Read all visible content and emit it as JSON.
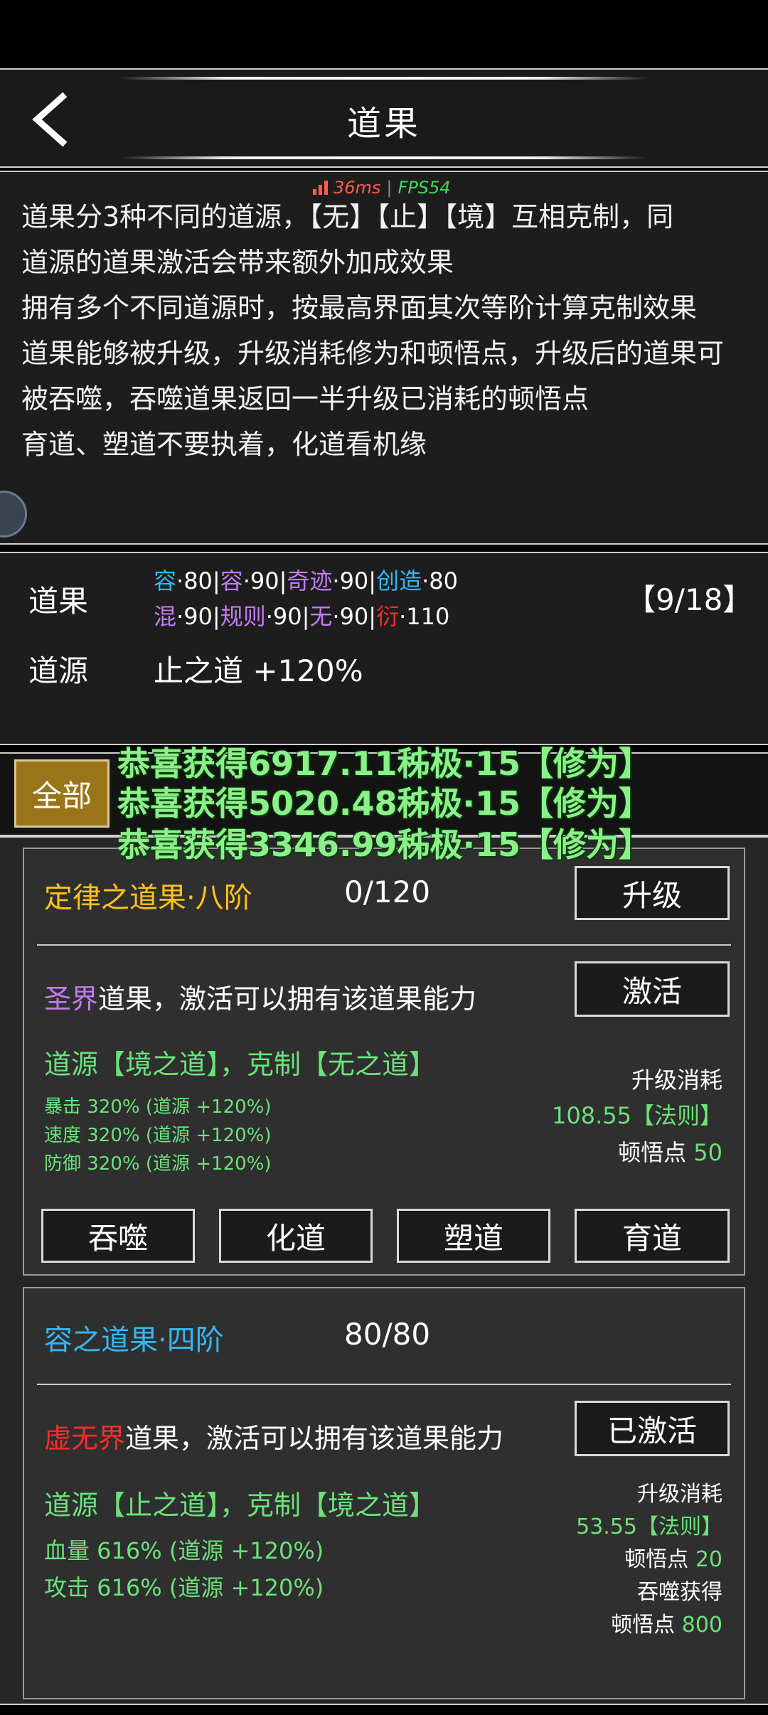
{
  "header": {
    "title": "道果"
  },
  "perf": {
    "ms": "36ms",
    "fps": "FPS54"
  },
  "description": {
    "lines": [
      "道果分3种不同的道源，【无】【止】【境】互相克制，同",
      "道源的道果激活会带来额外加成效果",
      "拥有多个不同道源时，按最高界面其次等阶计算克制效果",
      "道果能够被升级，升级消耗修为和顿悟点，升级后的道果可",
      "被吞噬，吞噬道果返回一半升级已消耗的顿悟点",
      "育道、塑道不要执着，化道看机缘"
    ]
  },
  "stats": {
    "daoguo_label": "道果",
    "daoyuan_label": "道源",
    "row1": [
      {
        "name": "容",
        "level": "·80",
        "color": "#35b6f0"
      },
      {
        "name": "容",
        "level": "·90",
        "color": "#c37bf2"
      },
      {
        "name": "奇迹",
        "level": "·90",
        "color": "#c37bf2"
      },
      {
        "name": "创造",
        "level": "·80",
        "color": "#35b6f0"
      }
    ],
    "row2": [
      {
        "name": "混",
        "level": "·90",
        "color": "#c37bf2"
      },
      {
        "name": "规则",
        "level": "·90",
        "color": "#c37bf2"
      },
      {
        "name": "无",
        "level": "·90",
        "color": "#c37bf2"
      },
      {
        "name": "衍",
        "level": "·110",
        "color": "#ff2c2c"
      }
    ],
    "count": "【9/18】",
    "daoyuan_value": "止之道 +120%"
  },
  "tabs": {
    "all": "全部"
  },
  "toasts": [
    "恭喜获得6917.11秭极·15【修为】",
    "恭喜获得5020.48秭极·15【修为】",
    "恭喜获得3346.99秭极·15【修为】"
  ],
  "cards": [
    {
      "name": "定律之道果·八阶",
      "progress": "0/120",
      "top_button": "升级",
      "realm": "圣界",
      "ability_text": "道果，激活可以拥有该道果能力",
      "activate_button": "激活",
      "daoyuan": "道源【境之道】，克制【无之道】",
      "effects": [
        "暴击 320% (道源 +120%)",
        "速度 320% (道源 +120%)",
        "防御 320% (道源 +120%)"
      ],
      "cost_label": "升级消耗",
      "cost_value": "108.55【法则】",
      "insight_label": "顿悟点",
      "insight_value": "50",
      "actions": [
        "吞噬",
        "化道",
        "塑道",
        "育道"
      ]
    },
    {
      "name": "容之道果·四阶",
      "progress": "80/80",
      "realm": "虚无界",
      "ability_text": "道果，激活可以拥有该道果能力",
      "activate_button": "已激活",
      "daoyuan": "道源【止之道】，克制【境之道】",
      "effects": [
        "血量 616% (道源 +120%)",
        "攻击 616% (道源 +120%)"
      ],
      "cost_label": "升级消耗",
      "cost_value": "53.55【法则】",
      "insight_label": "顿悟点",
      "insight_value": "20",
      "devour_label": "吞噬获得",
      "devour_insight_label": "顿悟点",
      "devour_insight_value": "800"
    }
  ]
}
